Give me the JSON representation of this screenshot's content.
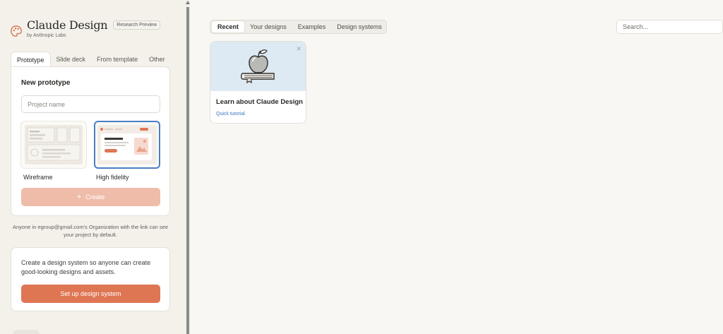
{
  "brand": {
    "title": "Claude Design",
    "badge": "Research Preview",
    "subtitle": "by Anthropic Labs",
    "icon": "palette-icon"
  },
  "new_tabs": [
    {
      "label": "Prototype",
      "active": true
    },
    {
      "label": "Slide deck",
      "active": false
    },
    {
      "label": "From template",
      "active": false
    },
    {
      "label": "Other",
      "active": false
    }
  ],
  "new_card": {
    "title": "New prototype",
    "project_placeholder": "Project name",
    "options": [
      {
        "label": "Wireframe",
        "selected": false
      },
      {
        "label": "High fidelity",
        "selected": true
      }
    ],
    "create_label": "Create",
    "create_icon": "plus-icon"
  },
  "share_note": "Anyone in egroup@gmail.com's Organization with the link can see your project by default.",
  "design_system": {
    "text": "Create a design system so anyone can create good-looking designs and assets.",
    "button_label": "Set up design system"
  },
  "main": {
    "tabs": [
      {
        "label": "Recent",
        "active": true
      },
      {
        "label": "Your designs",
        "active": false
      },
      {
        "label": "Examples",
        "active": false
      },
      {
        "label": "Design systems",
        "active": false
      }
    ],
    "search_placeholder": "Search...",
    "cards": [
      {
        "title": "Learn about Claude Design",
        "link": "Quick tutorial",
        "thumb_icon": "apple-on-book-icon",
        "close_icon": "close-icon"
      }
    ]
  },
  "colors": {
    "accent": "#de7654",
    "accent_disabled": "#f0bcaa",
    "selected_border": "#4a7fc4",
    "link": "#3b78c6",
    "thumb_bg": "#dde9f3"
  }
}
